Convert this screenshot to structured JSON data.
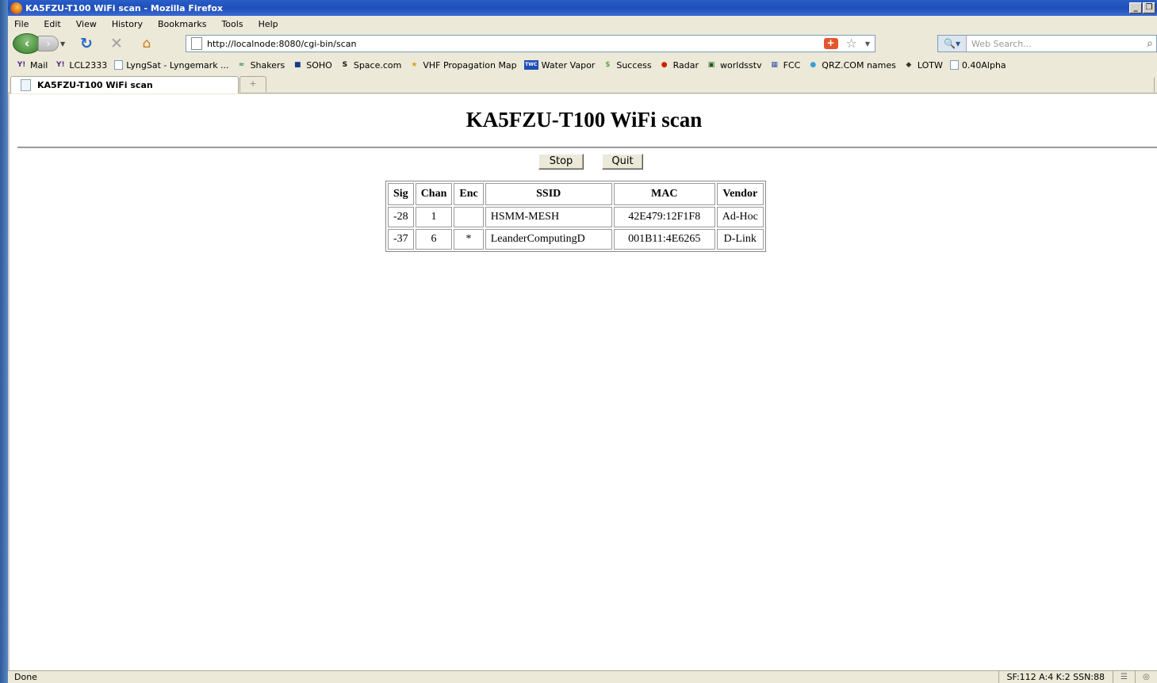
{
  "window": {
    "title": "KA5FZU-T100 WiFi scan - Mozilla Firefox",
    "controls": [
      "_",
      "Ͱ",
      "X"
    ]
  },
  "menu": [
    "File",
    "Edit",
    "View",
    "History",
    "Bookmarks",
    "Tools",
    "Help"
  ],
  "nav": {
    "url": "http://localnode:8080/cgi-bin/scan",
    "search_placeholder": "Web Search..."
  },
  "bookmarks": [
    {
      "label": "Mail",
      "icon": "yahoo-mail-icon",
      "color": "#5a2a8a"
    },
    {
      "label": "LCL2333",
      "icon": "yahoo-icon",
      "color": "#5a2a8a"
    },
    {
      "label": "LyngSat - Lyngemark ...",
      "icon": "page-icon",
      "color": "#7f9db9"
    },
    {
      "label": "Shakers",
      "icon": "shakers-icon",
      "color": "#2e8b57"
    },
    {
      "label": "SOHO",
      "icon": "soho-icon",
      "color": "#1a3a8a"
    },
    {
      "label": "Space.com",
      "icon": "space-icon",
      "color": "#111111"
    },
    {
      "label": "VHF Propagation Map",
      "icon": "propagation-icon",
      "color": "#d4a017"
    },
    {
      "label": "Water Vapor",
      "icon": "twc-icon",
      "color": "#1f4fb8"
    },
    {
      "label": "Success",
      "icon": "success-icon",
      "color": "#6aa84f"
    },
    {
      "label": "Radar",
      "icon": "radar-icon",
      "color": "#cc2200"
    },
    {
      "label": "worldsstv",
      "icon": "worldsstv-icon",
      "color": "#1e5e1e"
    },
    {
      "label": "FCC",
      "icon": "fcc-icon",
      "color": "#3355aa"
    },
    {
      "label": "QRZ.COM names",
      "icon": "qrz-icon",
      "color": "#3aa0d8"
    },
    {
      "label": "LOTW",
      "icon": "lotw-icon",
      "color": "#333333"
    },
    {
      "label": "0.40Alpha",
      "icon": "page-icon",
      "color": "#7f9db9"
    }
  ],
  "tabs": [
    {
      "label": "KA5FZU-T100 WiFi scan",
      "active": true
    }
  ],
  "page": {
    "heading": "KA5FZU-T100 WiFi scan",
    "stop_label": "Stop",
    "quit_label": "Quit",
    "table": {
      "headers": [
        "Sig",
        "Chan",
        "Enc",
        "SSID",
        "MAC",
        "Vendor"
      ],
      "rows": [
        [
          "-28",
          "1",
          "",
          "HSMM-MESH",
          "42E479:12F1F8",
          "Ad-Hoc"
        ],
        [
          "-37",
          "6",
          "*",
          "LeanderComputingD",
          "001B11:4E6265",
          "D-Link"
        ]
      ]
    }
  },
  "status": {
    "text": "Done",
    "panel": "SF:112 A:4 K:2 SSN:88"
  }
}
